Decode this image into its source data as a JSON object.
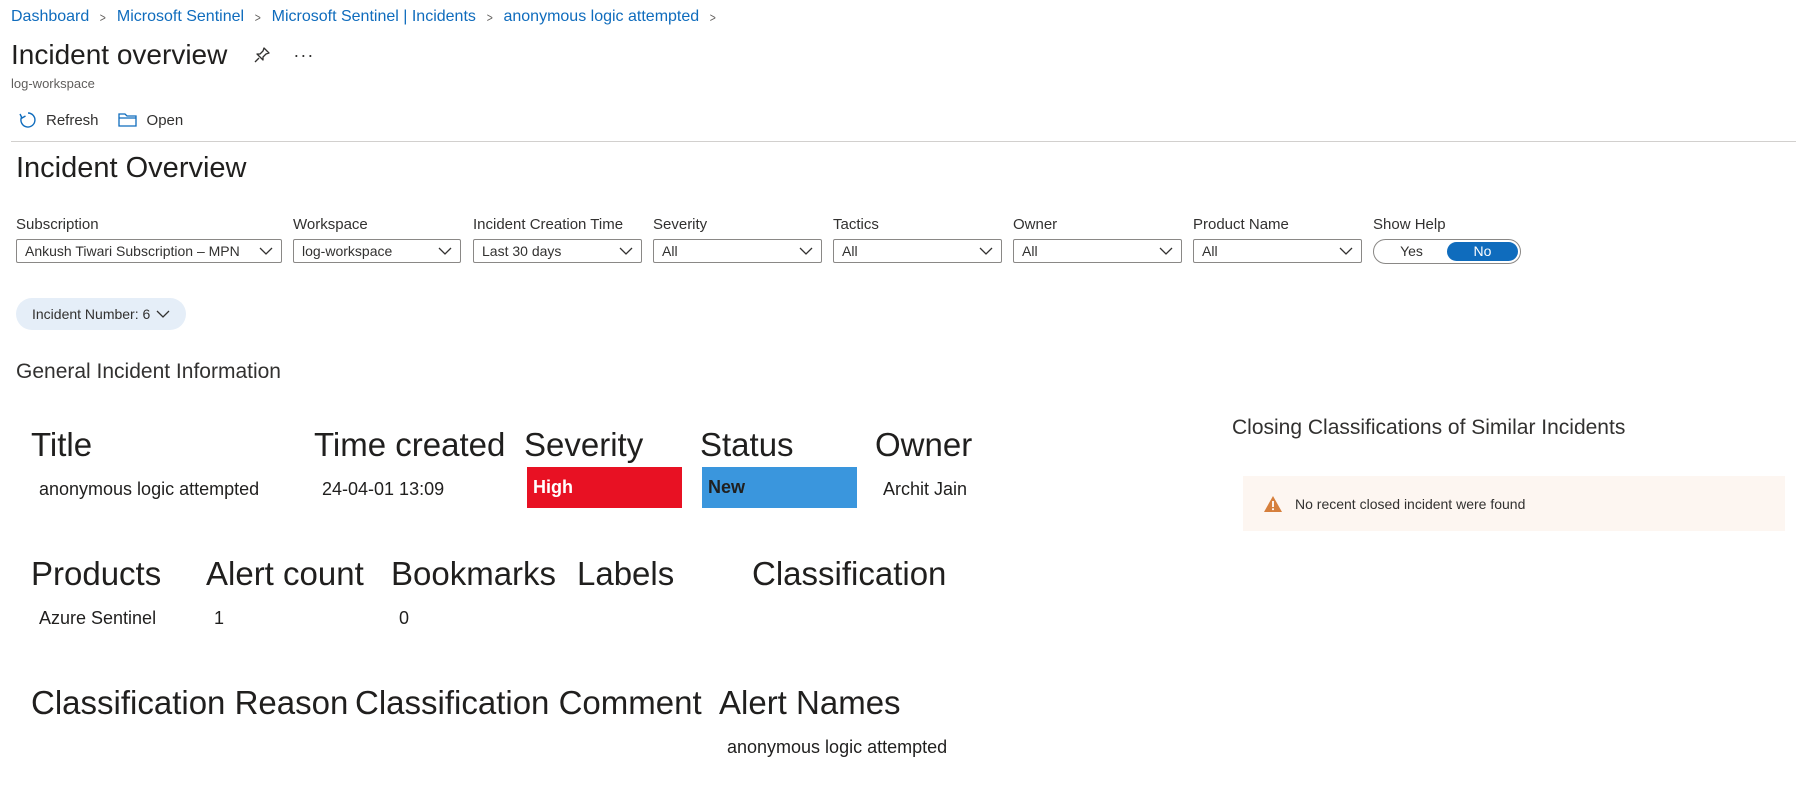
{
  "breadcrumb": [
    "Dashboard",
    "Microsoft Sentinel",
    "Microsoft Sentinel | Incidents",
    "anonymous logic attempted"
  ],
  "page": {
    "title": "Incident overview",
    "more": "···",
    "subtitle": "log-workspace"
  },
  "toolbar": {
    "refresh": "Refresh",
    "open": "Open"
  },
  "overview_heading": "Incident Overview",
  "params": {
    "subscription": {
      "label": "Subscription",
      "value": "Ankush Tiwari Subscription – MPN"
    },
    "workspace": {
      "label": "Workspace",
      "value": "log-workspace"
    },
    "creation_time": {
      "label": "Incident Creation Time",
      "value": "Last 30 days"
    },
    "severity": {
      "label": "Severity",
      "value": "All"
    },
    "tactics": {
      "label": "Tactics",
      "value": "All"
    },
    "owner": {
      "label": "Owner",
      "value": "All"
    },
    "product": {
      "label": "Product Name",
      "value": "All"
    },
    "show_help": {
      "label": "Show Help",
      "yes": "Yes",
      "no": "No",
      "selected": "No"
    }
  },
  "incident_pill": "Incident Number: 6",
  "general": {
    "heading": "General Incident Information",
    "title_h": "Title",
    "title_v": "anonymous logic attempted",
    "time_h": "Time created",
    "time_v": "24-04-01 13:09",
    "severity_h": "Severity",
    "severity_v": "High",
    "status_h": "Status",
    "status_v": "New",
    "owner_h": "Owner",
    "owner_v": "Archit Jain",
    "products_h": "Products",
    "products_v": "Azure Sentinel",
    "alertcount_h": "Alert count",
    "alertcount_v": "1",
    "bookmarks_h": "Bookmarks",
    "bookmarks_v": "0",
    "labels_h": "Labels",
    "classification_h": "Classification",
    "reason_h": "Classification Reason",
    "comment_h": "Classification Comment",
    "alertnames_h": "Alert Names",
    "alertnames_v": "anonymous logic attempted"
  },
  "closing": {
    "heading": "Closing Classifications of Similar Incidents",
    "warning": "No recent closed incident were found"
  },
  "colors": {
    "link": "#0f6cbd",
    "high": "#e81123",
    "new": "#3a96dd",
    "toggle_on": "#0f6cbd",
    "warn_bg": "#fdf6f1",
    "warn_icon": "#d67f3c"
  }
}
